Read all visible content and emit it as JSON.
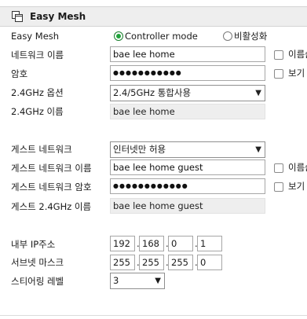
{
  "header": {
    "title": "Easy Mesh",
    "icon": "copy-windows-icon"
  },
  "easy_mesh": {
    "label": "Easy Mesh",
    "options": [
      {
        "label": "Controller mode",
        "selected": true
      },
      {
        "label": "비활성화",
        "selected": false
      }
    ]
  },
  "network_name": {
    "label": "네트워크 이름",
    "value": "bae lee home",
    "checkbox_label": "이름숨"
  },
  "password": {
    "label": "암호",
    "value": "●●●●●●●●●●●",
    "checkbox_label": "보기"
  },
  "band_option": {
    "label": "2.4GHz 옵션",
    "value": "2.4/5GHz 통합사용"
  },
  "name_24": {
    "label": "2.4GHz 이름",
    "value": "bae lee home"
  },
  "guest_network": {
    "label": "게스트 네트워크",
    "value": "인터넷만 허용"
  },
  "guest_name": {
    "label": "게스트 네트워크 이름",
    "value": "bae lee home guest",
    "checkbox_label": "이름숨"
  },
  "guest_password": {
    "label": "게스트 네트워크 암호",
    "value": "●●●●●●●●●●●●",
    "checkbox_label": "보기"
  },
  "guest_name_24": {
    "label": "게스트 2.4GHz 이름",
    "value": "bae lee home guest"
  },
  "internal_ip": {
    "label": "내부 IP주소",
    "octets": [
      "192",
      "168",
      "0",
      "1"
    ]
  },
  "subnet_mask": {
    "label": "서브넷 마스크",
    "octets": [
      "255",
      "255",
      "255",
      "0"
    ]
  },
  "steering_level": {
    "label": "스티어링 레벨",
    "value": "3"
  },
  "separator": "."
}
